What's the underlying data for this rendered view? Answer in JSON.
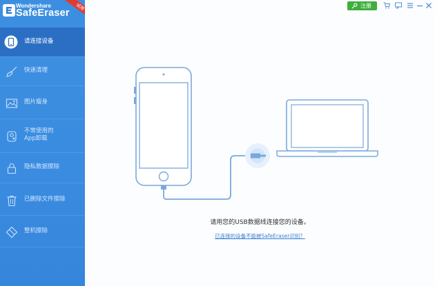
{
  "brand": {
    "company": "Wondershare",
    "product": "SafeEraser",
    "ribbon": "试用"
  },
  "nav": {
    "items": [
      {
        "label": "请连接设备",
        "icon": "phone-icon",
        "active": true
      },
      {
        "label": "快速清理",
        "icon": "broom-icon"
      },
      {
        "label": "图片瘦身",
        "icon": "picture-icon"
      },
      {
        "label": "不常使用的\nApp卸载",
        "icon": "app-icon"
      },
      {
        "label": "隐私数据擦除",
        "icon": "lock-icon"
      },
      {
        "label": "已删除文件擦除",
        "icon": "trash-icon"
      },
      {
        "label": "整机擦除",
        "icon": "eraser-icon"
      }
    ]
  },
  "topbar": {
    "register_label": "注册",
    "icons": [
      "cart-icon",
      "feedback-icon",
      "menu-icon",
      "minimize-icon",
      "close-icon"
    ]
  },
  "main": {
    "instruction": "请用您的USB数据线连接您的设备。",
    "help_link": "已连接的设备不能被SafeEraser识别？"
  },
  "colors": {
    "sidebar": "#3a8ce0",
    "sidebar_active": "#2b6fc4",
    "illustration": "#7aa8dc",
    "register_button": "#3fae3c",
    "link": "#3a7fd0"
  }
}
